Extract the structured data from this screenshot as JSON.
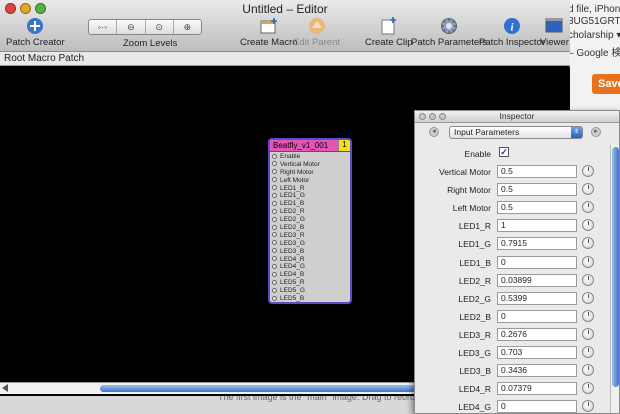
{
  "window": {
    "title": "Untitled – Editor",
    "toolbar": {
      "patch_creator": "Patch Creator",
      "zoom_levels": "Zoom Levels",
      "create_macro": "Create Macro",
      "edit_parent": "Edit Parent",
      "create_clip": "Create Clip",
      "patch_parameters": "Patch Parameters",
      "patch_inspector": "Patch Inspector",
      "viewer": "Viewer"
    },
    "breadcrumb": "Root Macro Patch"
  },
  "colors": {
    "patch_header": "#e455b8",
    "patch_border": "#5a4fc8",
    "patch_badge": "#f2e11a",
    "accent_blue": "#3a74cc"
  },
  "patch": {
    "title": "Beatfly_v1_001",
    "badge": "1",
    "ports": [
      "Enable",
      "Vertical Motor",
      "Right Motor",
      "Left Motor",
      "LED1_R",
      "LED1_G",
      "LED1_B",
      "LED2_R",
      "LED2_G",
      "LED2_B",
      "LED3_R",
      "LED3_G",
      "LED3_B",
      "LED4_R",
      "LED4_G",
      "LED4_B",
      "LED5_R",
      "LED5_G",
      "LED5_B"
    ]
  },
  "inspector": {
    "title": "Inspector",
    "mode": "Input Parameters",
    "enable_label": "Enable",
    "params": [
      {
        "label": "Vertical Motor",
        "value": "0.5"
      },
      {
        "label": "Right Motor",
        "value": "0.5"
      },
      {
        "label": "Left Motor",
        "value": "0.5"
      },
      {
        "label": "LED1_R",
        "value": "1"
      },
      {
        "label": "LED1_G",
        "value": "0.7915"
      },
      {
        "label": "LED1_B",
        "value": "0"
      },
      {
        "label": "LED2_R",
        "value": "0.03899"
      },
      {
        "label": "LED2_G",
        "value": "0.5399"
      },
      {
        "label": "LED2_B",
        "value": "0"
      },
      {
        "label": "LED3_R",
        "value": "0.2676"
      },
      {
        "label": "LED3_G",
        "value": "0.703"
      },
      {
        "label": "LED3_B",
        "value": "0.3436"
      },
      {
        "label": "LED4_R",
        "value": "0.07379"
      },
      {
        "label": "LED4_G",
        "value": "0"
      }
    ]
  },
  "background": {
    "lines": [
      "d file, iPhon",
      "3UG51GRT0U",
      "cholarship ▾",
      "– Google 検索"
    ],
    "save_label": "Save",
    "caption": "The first image is the \"main\" image. Drag to reorder."
  }
}
